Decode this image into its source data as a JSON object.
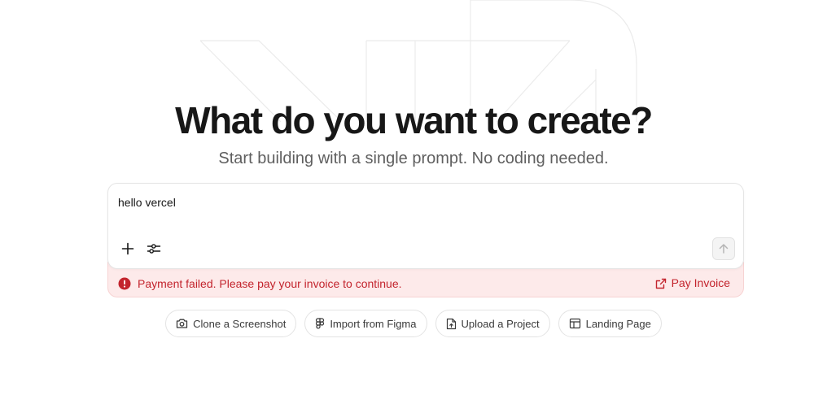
{
  "hero": {
    "title": "What do you want to create?",
    "subtitle": "Start building with a single prompt. No coding needed."
  },
  "prompt": {
    "value": "hello vercel"
  },
  "toolbar": {
    "attach_icon": "plus-icon",
    "settings_icon": "sliders-icon",
    "send_icon": "arrow-up-icon"
  },
  "error": {
    "message": "Payment failed. Please pay your invoice to continue.",
    "action_label": "Pay Invoice",
    "icon": "alert-circle-icon",
    "color": "#c3242d",
    "background": "#fdeaea"
  },
  "suggestions": [
    {
      "label": "Clone a Screenshot",
      "icon": "camera-icon"
    },
    {
      "label": "Import from Figma",
      "icon": "figma-icon"
    },
    {
      "label": "Upload a Project",
      "icon": "file-upload-icon"
    },
    {
      "label": "Landing Page",
      "icon": "layout-icon"
    }
  ]
}
